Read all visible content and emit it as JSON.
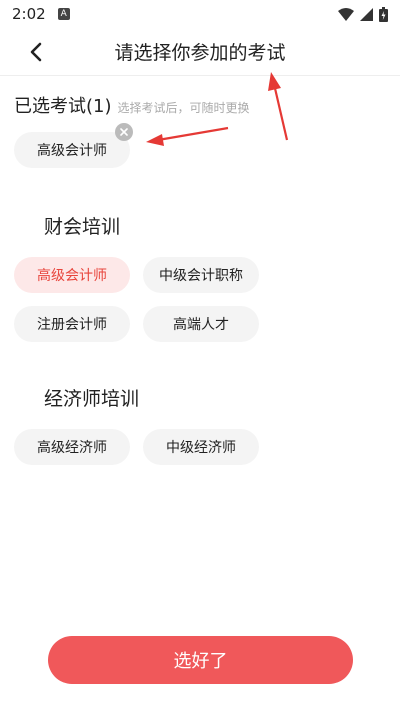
{
  "status_bar": {
    "time": "2:02",
    "a_badge": "A"
  },
  "header": {
    "title": "请选择你参加的考试",
    "back_icon": "chevron-left-icon"
  },
  "selected": {
    "title": "已选考试(1)",
    "hint": "选择考试后，可随时更换",
    "chips": [
      {
        "label": "高级会计师"
      }
    ]
  },
  "sections": [
    {
      "title": "财会培训",
      "items": [
        {
          "label": "高级会计师",
          "active": true
        },
        {
          "label": "中级会计职称",
          "active": false
        },
        {
          "label": "注册会计师",
          "active": false
        },
        {
          "label": "高端人才",
          "active": false
        }
      ]
    },
    {
      "title": "经济师培训",
      "items": [
        {
          "label": "高级经济师",
          "active": false
        },
        {
          "label": "中级经济师",
          "active": false
        }
      ]
    }
  ],
  "confirm": {
    "label": "选好了"
  },
  "colors": {
    "accent": "#f0585a",
    "active_bg": "#fde8e8",
    "active_text": "#e8453c",
    "chip_bg": "#f4f4f4",
    "annotation": "#e53935"
  }
}
